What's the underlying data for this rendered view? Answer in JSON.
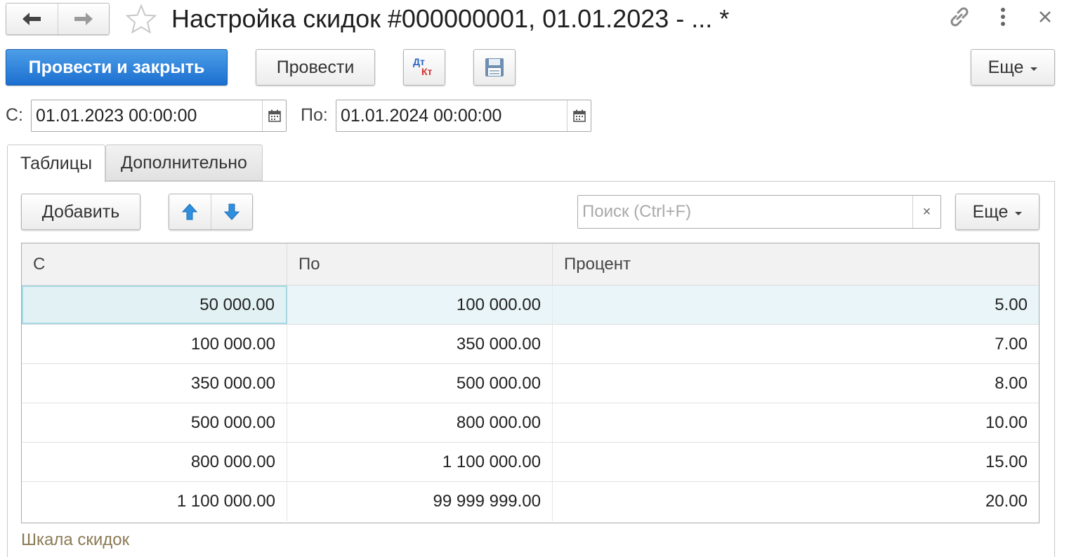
{
  "window": {
    "title": "Настройка скидок #000000001, 01.01.2023 - ... *",
    "back_icon": "arrow-left-icon",
    "forward_icon": "arrow-right-icon",
    "favorite_icon": "star-icon",
    "link_icon": "link-icon",
    "menu_icon": "more-vertical-icon",
    "close_icon": "close-icon"
  },
  "toolbar": {
    "post_close_label": "Провести и закрыть",
    "post_label": "Провести",
    "dtkt_top": "Дт",
    "dtkt_bottom": "Кт",
    "more_label": "Еще"
  },
  "period": {
    "from_label": "С:",
    "from_value": "01.01.2023 00:00:00",
    "to_label": "По:",
    "to_value": "01.01.2024 00:00:00"
  },
  "tabs": [
    {
      "label": "Таблицы",
      "active": true
    },
    {
      "label": "Дополнительно",
      "active": false
    }
  ],
  "table_toolbar": {
    "add_label": "Добавить",
    "search_placeholder": "Поиск (Ctrl+F)",
    "search_clear": "×",
    "more_label": "Еще"
  },
  "table": {
    "columns": [
      "С",
      "По",
      "Процент"
    ],
    "rows": [
      [
        "50 000.00",
        "100 000.00",
        "5.00"
      ],
      [
        "100 000.00",
        "350 000.00",
        "7.00"
      ],
      [
        "350 000.00",
        "500 000.00",
        "8.00"
      ],
      [
        "500 000.00",
        "800 000.00",
        "10.00"
      ],
      [
        "800 000.00",
        "1 100 000.00",
        "15.00"
      ],
      [
        "1 100 000.00",
        "99 999 999.00",
        "20.00"
      ]
    ]
  },
  "footer": {
    "link_label": "Шкала скидок"
  },
  "colors": {
    "primary": "#1c6fd0",
    "selected_row": "#e9f5f8",
    "footer_link": "#8b7a54"
  }
}
